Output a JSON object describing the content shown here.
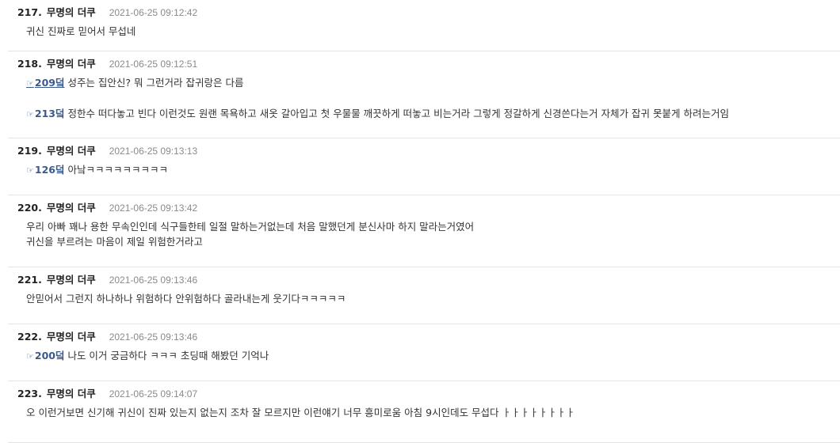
{
  "comments": [
    {
      "number": "217.",
      "author": "무명의 더쿠",
      "date": "2021-06-25 09:12:42",
      "text": "귀신 진짜로 믿어서 무섭네"
    },
    {
      "number": "218.",
      "author": "무명의 더쿠",
      "date": "2021-06-25 09:12:51",
      "lines": [
        {
          "icon": "☞",
          "ref": "209덬",
          "text": " 성주는 집안신? 뭐 그런거라 잡귀랑은 다름"
        },
        {
          "icon": "☞",
          "ref": "213덬",
          "text": " 정한수 떠다놓고 빈다 이런것도 원랜 목욕하고 새옷 갈아입고 첫 우물물 깨끗하게 떠놓고 비는거라 그렇게 정갈하게 신경쓴다는거 자체가 잡귀 못붙게 하려는거임"
        }
      ]
    },
    {
      "number": "219.",
      "author": "무명의 더쿠",
      "date": "2021-06-25 09:13:13",
      "lines": [
        {
          "icon": "☞",
          "ref": "126덬",
          "text": " 아낰ㅋㅋㅋㅋㅋㅋㅋㅋㅋ"
        }
      ]
    },
    {
      "number": "220.",
      "author": "무명의 더쿠",
      "date": "2021-06-25 09:13:42",
      "line1": "우리 아빠 꽤나 용한 무속인인데 식구들한테 일절 말하는거없는데 처음 말했던게 분신사마 하지 말라는거였어",
      "line2": "귀신을 부르려는 마음이 제일 위험한거라고"
    },
    {
      "number": "221.",
      "author": "무명의 더쿠",
      "date": "2021-06-25 09:13:46",
      "text": "안믿어서 그런지 하나하나 위험하다 안위험하다 골라내는게 웃기다ㅋㅋㅋㅋㅋ"
    },
    {
      "number": "222.",
      "author": "무명의 더쿠",
      "date": "2021-06-25 09:13:46",
      "lines": [
        {
          "icon": "☞",
          "ref": "200덬",
          "text": "  나도 이거 궁금하다 ㅋㅋㅋ 초딩때 해봤던 기억나"
        }
      ]
    },
    {
      "number": "223.",
      "author": "무명의 더쿠",
      "date": "2021-06-25 09:14:07",
      "text": "오 이런거보면 신기해 귀신이 진짜 있는지 없는지 조차 잘 모르지만 이런얘기 너무 흥미로움 아침 9시인데도 무섭다 ㅏㅏㅏㅏㅏㅏㅏㅏ"
    }
  ]
}
